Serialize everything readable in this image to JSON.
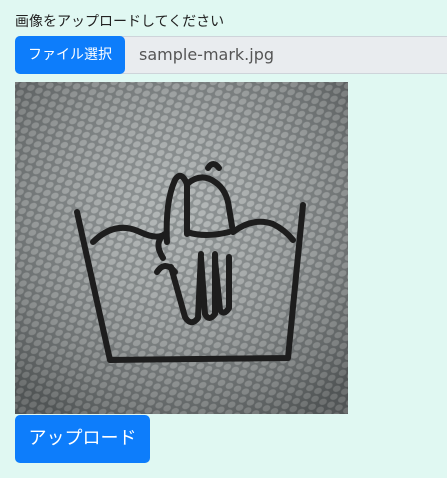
{
  "form": {
    "prompt": "画像をアップロードしてください",
    "choose_file_label": "ファイル選択",
    "file_name": "sample-mark.jpg",
    "upload_label": "アップロード"
  },
  "preview": {
    "icon": "hand-wash-icon"
  },
  "colors": {
    "background": "#e0f8f2",
    "accent": "#0d7dfb"
  }
}
